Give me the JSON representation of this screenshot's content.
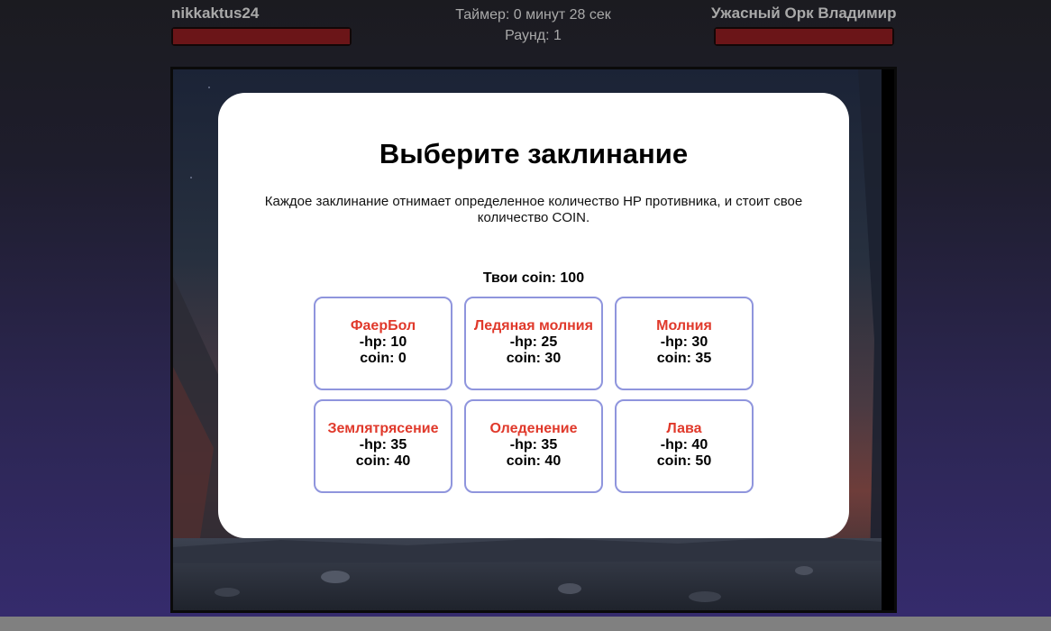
{
  "header": {
    "player_name": "nikkaktus24",
    "enemy_name": "Ужасный Орк Владимир",
    "timer": "Таймер: 0 минут 28 сек",
    "round": "Раунд: 1",
    "player_hp_fraction": 1.0,
    "enemy_hp_fraction": 1.0
  },
  "modal": {
    "title": "Выберите заклинание",
    "description": "Каждое заклинание отнимает определенное количество HP противника, и стоит свое количество COIN.",
    "coins": "Твои coin: 100",
    "spells": [
      {
        "name": "ФаерБол",
        "hp": "-hp: 10",
        "coin": "coin: 0"
      },
      {
        "name": "Ледяная молния",
        "hp": "-hp: 25",
        "coin": "coin: 30"
      },
      {
        "name": "Молния",
        "hp": "-hp: 30",
        "coin": "coin: 35"
      },
      {
        "name": "Землятрясение",
        "hp": "-hp: 35",
        "coin": "coin: 40"
      },
      {
        "name": "Оледенение",
        "hp": "-hp: 35",
        "coin": "coin: 40"
      },
      {
        "name": "Лава",
        "hp": "-hp: 40",
        "coin": "coin: 50"
      }
    ]
  },
  "colors": {
    "spell_name": "#e0392b",
    "card_border": "#8f95dd",
    "hp_bar": "#6b1518",
    "header_text": "#a9a9a9"
  }
}
